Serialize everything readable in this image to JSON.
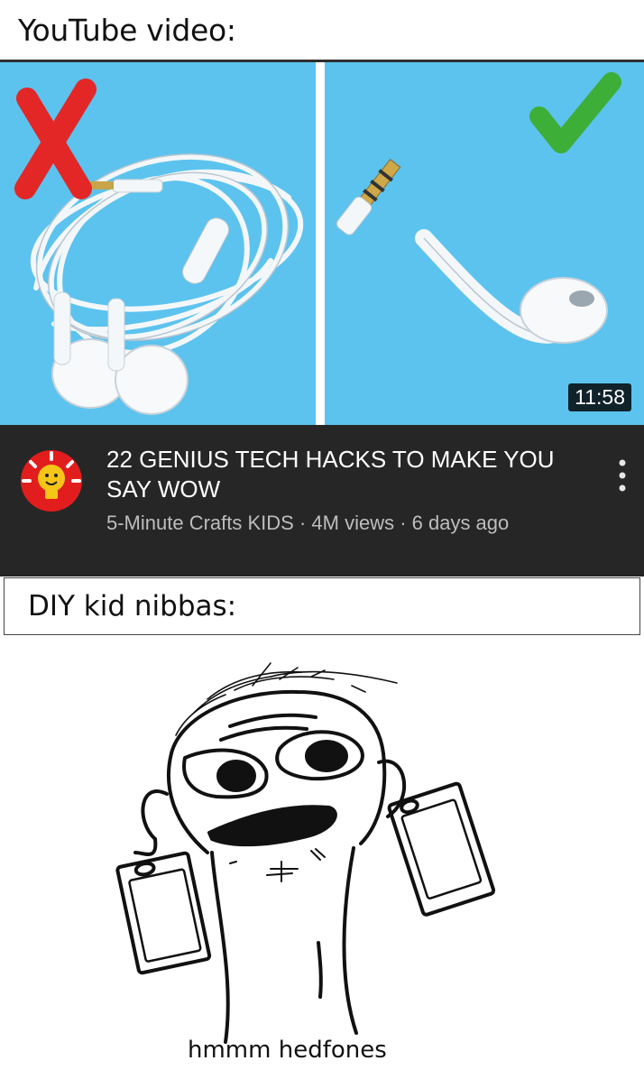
{
  "top_caption": "YouTube video:",
  "thumbnail": {
    "left_mark_icon": "red-x-icon",
    "right_mark_icon": "green-check-icon",
    "duration": "11:58"
  },
  "video": {
    "title": "22 GENIUS TECH HACKS TO MAKE YOU SAY WOW",
    "meta": "5-Minute Crafts KIDS · 4M views · 6 days ago",
    "more_icon": "vertical-ellipsis-icon"
  },
  "second_caption": "DIY kid nibbas:",
  "drawing_caption": "hmmm hedfones",
  "colors": {
    "thumbnail_bg": "#5cc3ee",
    "info_bar_bg": "#262626",
    "x_red": "#e32727",
    "check_green": "#3dae37",
    "avatar_red": "#e21d1d",
    "avatar_yellow": "#f5c518"
  }
}
